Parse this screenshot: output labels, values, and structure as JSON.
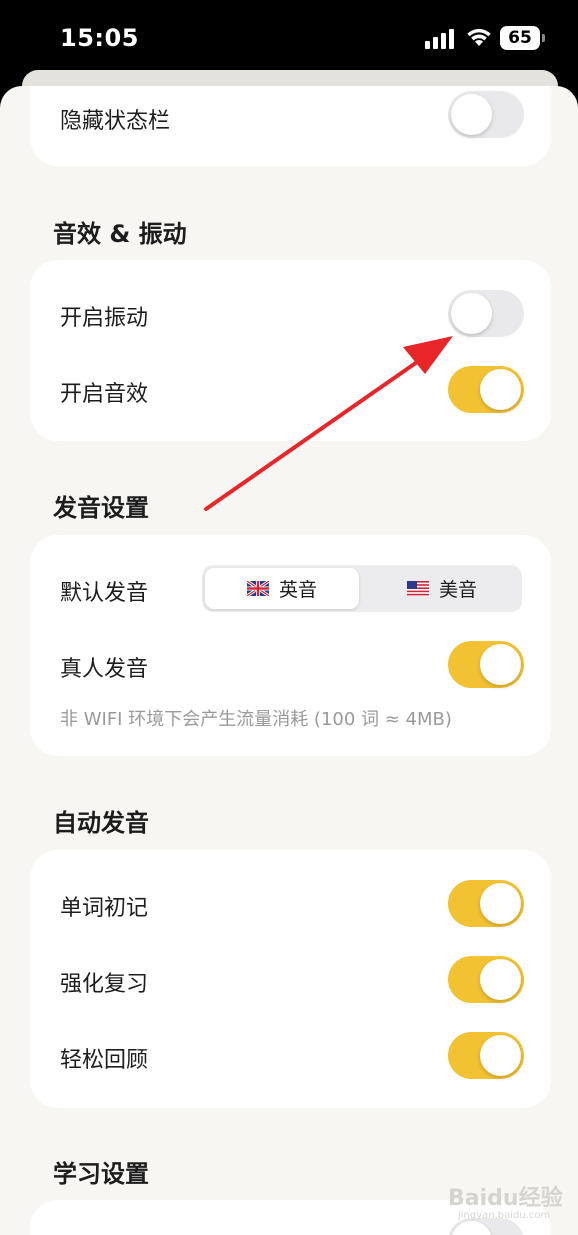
{
  "status_bar": {
    "time": "15:05",
    "battery": "65"
  },
  "top_card": {
    "hide_status_bar_label": "隐藏状态栏",
    "hide_status_bar_on": false
  },
  "sound_section": {
    "title": "音效 & 振动",
    "vibration_label": "开启振动",
    "vibration_on": false,
    "sound_label": "开启音效",
    "sound_on": true
  },
  "pronunciation_section": {
    "title": "发音设置",
    "default_label": "默认发音",
    "options": [
      {
        "label": "英音",
        "flag": "uk-flag-icon",
        "selected": true
      },
      {
        "label": "美音",
        "flag": "us-flag-icon",
        "selected": false
      }
    ],
    "real_voice_label": "真人发音",
    "real_voice_on": true,
    "note": "非 WIFI 环境下会产生流量消耗 (100 词 ≈ 4MB)"
  },
  "auto_section": {
    "title": "自动发音",
    "items": [
      {
        "label": "单词初记",
        "on": true
      },
      {
        "label": "强化复习",
        "on": true
      },
      {
        "label": "轻松回顾",
        "on": true
      }
    ]
  },
  "study_section": {
    "title": "学习设置"
  },
  "watermark": {
    "text": "Baidu经验",
    "sub": "jingyan.baidu.com"
  },
  "colors": {
    "accent": "#f2c233",
    "background": "#f7f6f3",
    "arrow": "#e8262a"
  }
}
